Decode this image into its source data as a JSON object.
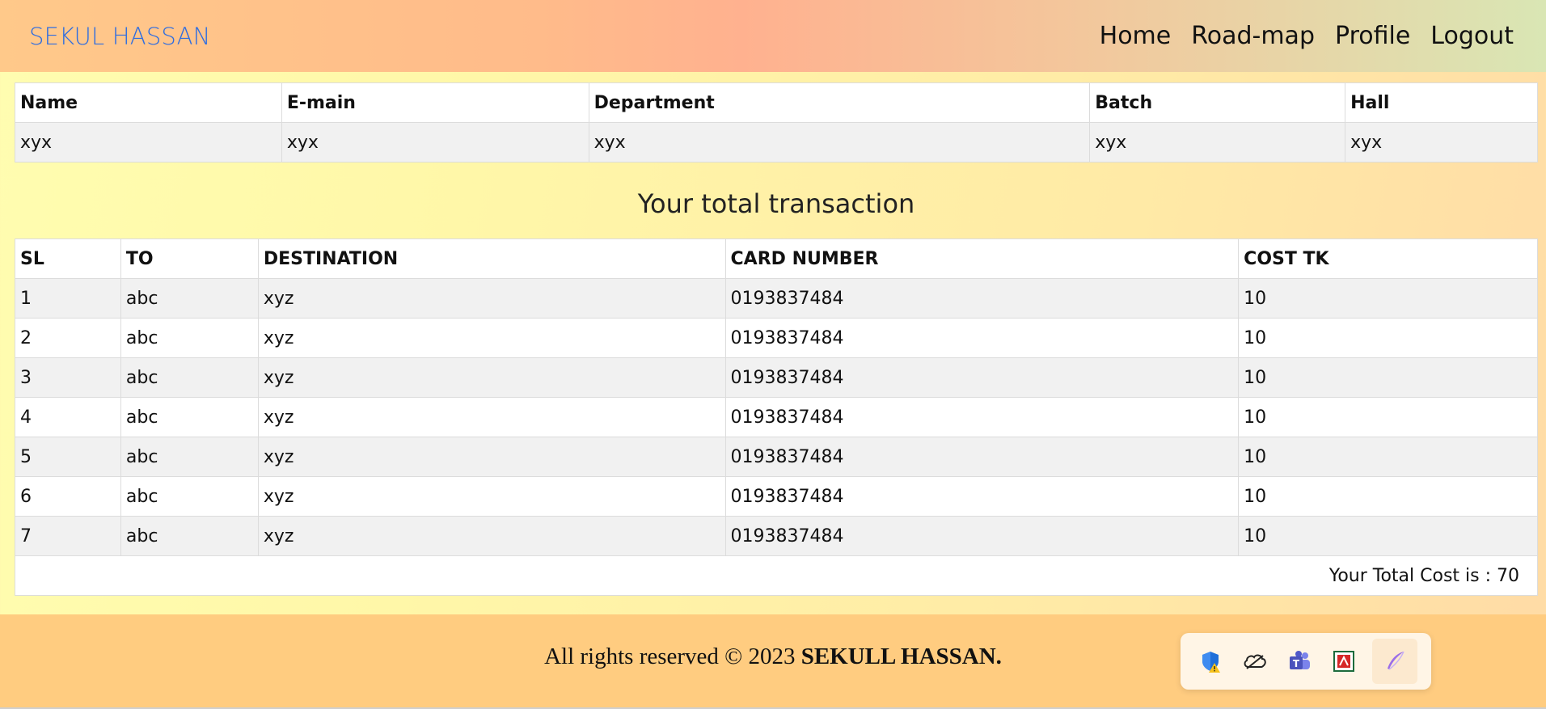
{
  "navbar": {
    "brand": "SEKUL HASSAN",
    "links": [
      "Home",
      "Road-map",
      "Profile",
      "Logout"
    ]
  },
  "profile_table": {
    "headers": [
      "Name",
      "E-main",
      "Department",
      "Batch",
      "Hall"
    ],
    "row": [
      "xyx",
      "xyx",
      "xyx",
      "xyx",
      "xyx"
    ]
  },
  "transactions": {
    "title": "Your total transaction",
    "headers": [
      "SL",
      "TO",
      "DESTINATION",
      "CARD NUMBER",
      "COST TK"
    ],
    "rows": [
      [
        "1",
        "abc",
        "xyz",
        "0193837484",
        "10"
      ],
      [
        "2",
        "abc",
        "xyz",
        "0193837484",
        "10"
      ],
      [
        "3",
        "abc",
        "xyz",
        "0193837484",
        "10"
      ],
      [
        "4",
        "abc",
        "xyz",
        "0193837484",
        "10"
      ],
      [
        "5",
        "abc",
        "xyz",
        "0193837484",
        "10"
      ],
      [
        "6",
        "abc",
        "xyz",
        "0193837484",
        "10"
      ],
      [
        "7",
        "abc",
        "xyz",
        "0193837484",
        "10"
      ]
    ],
    "total_text": "Your Total Cost is : 70"
  },
  "footer": {
    "prefix": "All rights reserved © 2023 ",
    "name": "SEKULL HASSAN."
  },
  "tray": {
    "icons": [
      "defender-warning-icon",
      "onedrive-offline-icon",
      "teams-icon",
      "pdf-app-icon",
      "pen-feather-icon"
    ]
  }
}
